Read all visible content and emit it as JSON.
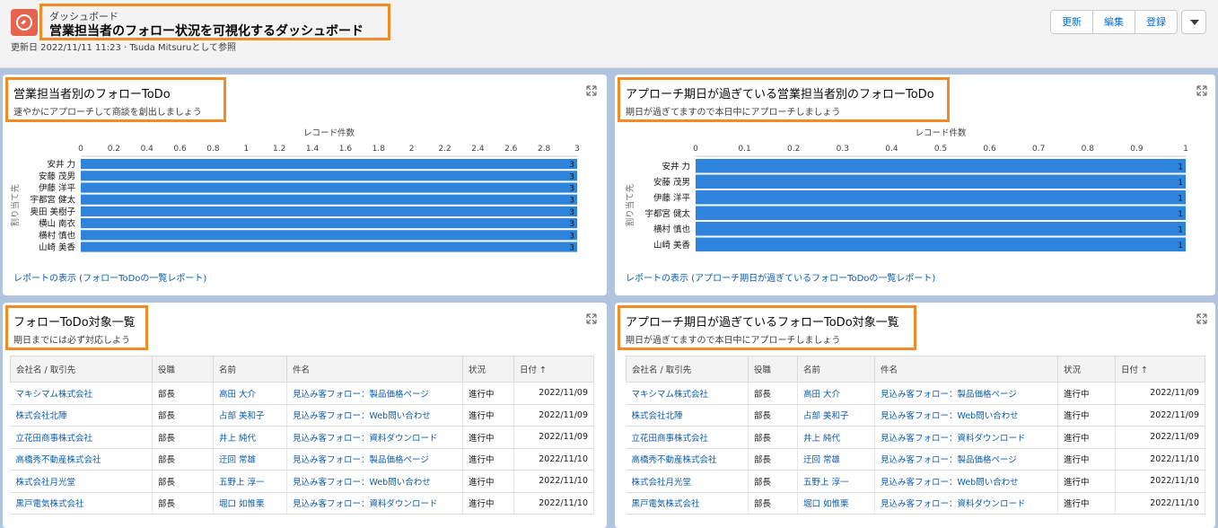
{
  "header": {
    "subtitle": "ダッシュボード",
    "title": "営業担当者のフォロー状況を可視化するダッシュボード",
    "meta": "更新日 2022/11/11 11:23 · Tsuda Mitsuruとして参照",
    "buttons": [
      "更新",
      "編集",
      "登録"
    ]
  },
  "cards": {
    "tl": {
      "title": "営業担当者別のフォローToDo",
      "subtitle": "速やかにアプローチして商談を創出しましょう",
      "link": "レポートの表示 (フォローToDoの一覧レポート)"
    },
    "tr": {
      "title": "アプローチ期日が過ぎている営業担当者別のフォローToDo",
      "subtitle": "期日が過ぎてますので本日中にアプローチしましょう",
      "link": "レポートの表示 (アプローチ期日が過ぎているフォローToDoの一覧レポート)"
    },
    "bl": {
      "title": "フォローToDo対象一覧",
      "subtitle": "期日までには必ず対応しよう"
    },
    "br": {
      "title": "アプローチ期日が過ぎているフォローToDo対象一覧",
      "subtitle": "期日が過ぎてますので本日中にアプローチしましょう"
    }
  },
  "chart_data": [
    {
      "type": "bar",
      "orientation": "horizontal",
      "xlabel": "レコード件数",
      "ylabel": "割り当て先",
      "xlim": [
        0,
        3
      ],
      "ticks": [
        "0",
        "0.2",
        "0.4",
        "0.6",
        "0.8",
        "1",
        "1.2",
        "1.4",
        "1.6",
        "1.8",
        "2",
        "2.2",
        "2.4",
        "2.6",
        "2.8",
        "3"
      ],
      "categories": [
        "安井 力",
        "安藤 茂男",
        "伊藤 洋平",
        "宇都宮 健太",
        "奥田 美樹子",
        "横山 南衣",
        "横村 慎也",
        "山崎 美香"
      ],
      "values": [
        3,
        3,
        3,
        3,
        3,
        3,
        3,
        3
      ],
      "color": "#2e84dc"
    },
    {
      "type": "bar",
      "orientation": "horizontal",
      "xlabel": "レコード件数",
      "ylabel": "割り当て先",
      "xlim": [
        0,
        1
      ],
      "ticks": [
        "0",
        "0.1",
        "0.2",
        "0.3",
        "0.4",
        "0.5",
        "0.6",
        "0.7",
        "0.8",
        "0.9",
        "1"
      ],
      "categories": [
        "安井 力",
        "安藤 茂男",
        "伊藤 洋平",
        "宇都宮 健太",
        "横村 慎也",
        "山崎 美香"
      ],
      "values": [
        1,
        1,
        1,
        1,
        1,
        1
      ],
      "color": "#2e84dc"
    }
  ],
  "tables": {
    "columns": [
      "会社名 / 取引先",
      "役職",
      "名前",
      "件名",
      "状況",
      "日付 ↑"
    ],
    "rows": [
      [
        "マキシマム株式会社",
        "部長",
        "高田 大介",
        "見込み客フォロー：製品価格ページ",
        "進行中",
        "2022/11/09"
      ],
      [
        "株式会社北陣",
        "部長",
        "占部 美和子",
        "見込み客フォロー：Web問い合わせ",
        "進行中",
        "2022/11/09"
      ],
      [
        "立花田商事株式会社",
        "部長",
        "井上 純代",
        "見込み客フォロー：資料ダウンロード",
        "進行中",
        "2022/11/09"
      ],
      [
        "高橋秀不動産株式会社",
        "部長",
        "迂回 常雄",
        "見込み客フォロー：製品価格ページ",
        "進行中",
        "2022/11/10"
      ],
      [
        "株式会社月光堂",
        "部長",
        "五野上 淳一",
        "見込み客フォロー：Web問い合わせ",
        "進行中",
        "2022/11/10"
      ],
      [
        "黒戸電気株式会社",
        "部長",
        "堀口 如惟栗",
        "見込み客フォロー：資料ダウンロード",
        "進行中",
        "2022/11/10"
      ]
    ]
  }
}
